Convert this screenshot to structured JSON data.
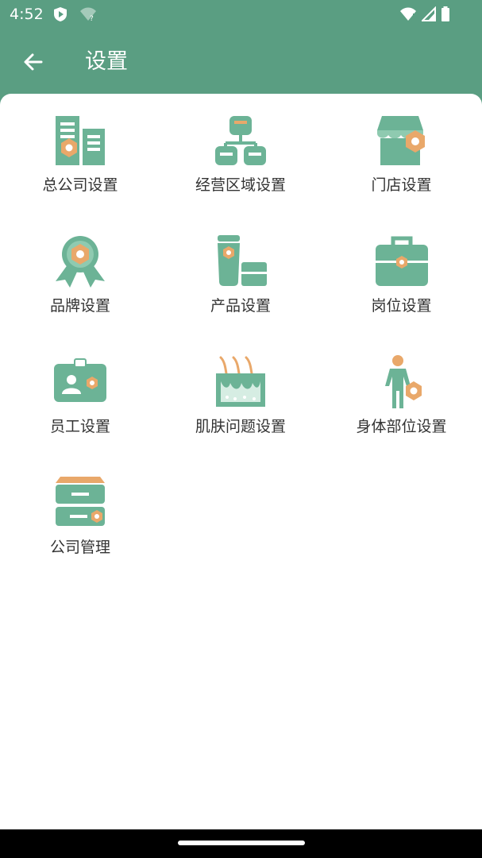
{
  "status_bar": {
    "time": "4:52",
    "icons_left": [
      "shield-icon",
      "wifi-question-icon"
    ],
    "icons_right": [
      "wifi-alert-icon",
      "signal-icon",
      "battery-icon"
    ]
  },
  "app_bar": {
    "title": "设置",
    "back_icon": "arrow-left-icon"
  },
  "colors": {
    "primary": "#5a9e82",
    "icon_green": "#6cb396",
    "icon_orange": "#e9a86a",
    "text": "#333333"
  },
  "settings_items": [
    {
      "label": "总公司设置",
      "icon": "headquarters-icon"
    },
    {
      "label": "经营区域设置",
      "icon": "region-hierarchy-icon"
    },
    {
      "label": "门店设置",
      "icon": "store-icon"
    },
    {
      "label": "品牌设置",
      "icon": "brand-award-icon"
    },
    {
      "label": "产品设置",
      "icon": "product-icon"
    },
    {
      "label": "岗位设置",
      "icon": "briefcase-icon"
    },
    {
      "label": "员工设置",
      "icon": "employee-card-icon"
    },
    {
      "label": "肌肤问题设置",
      "icon": "skin-issue-icon"
    },
    {
      "label": "身体部位设置",
      "icon": "body-part-icon"
    },
    {
      "label": "公司管理",
      "icon": "cabinet-icon"
    }
  ]
}
